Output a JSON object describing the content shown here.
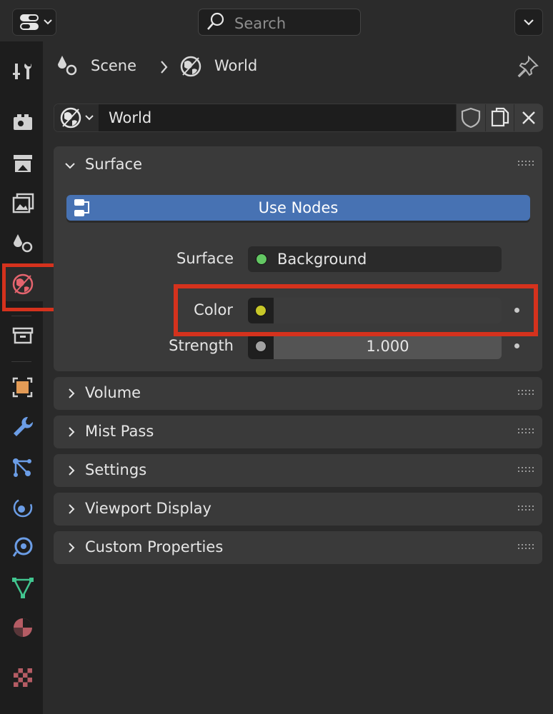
{
  "header": {
    "search_placeholder": "Search"
  },
  "breadcrumb": {
    "scene_label": "Scene",
    "world_label": "World"
  },
  "datablock": {
    "name": "World"
  },
  "surface_panel": {
    "title": "Surface",
    "use_nodes_label": "Use Nodes",
    "surface_label": "Surface",
    "surface_value": "Background",
    "color_label": "Color",
    "strength_label": "Strength",
    "strength_value": "1.000"
  },
  "panels": [
    {
      "title": "Volume"
    },
    {
      "title": "Mist Pass"
    },
    {
      "title": "Settings"
    },
    {
      "title": "Viewport Display"
    },
    {
      "title": "Custom Properties"
    }
  ],
  "colors": {
    "accent_blue": "#4772b3",
    "highlight_red": "#d5321d",
    "socket_green": "#63c763",
    "socket_yellow": "#c7c729",
    "socket_gray": "#a1a1a1"
  }
}
